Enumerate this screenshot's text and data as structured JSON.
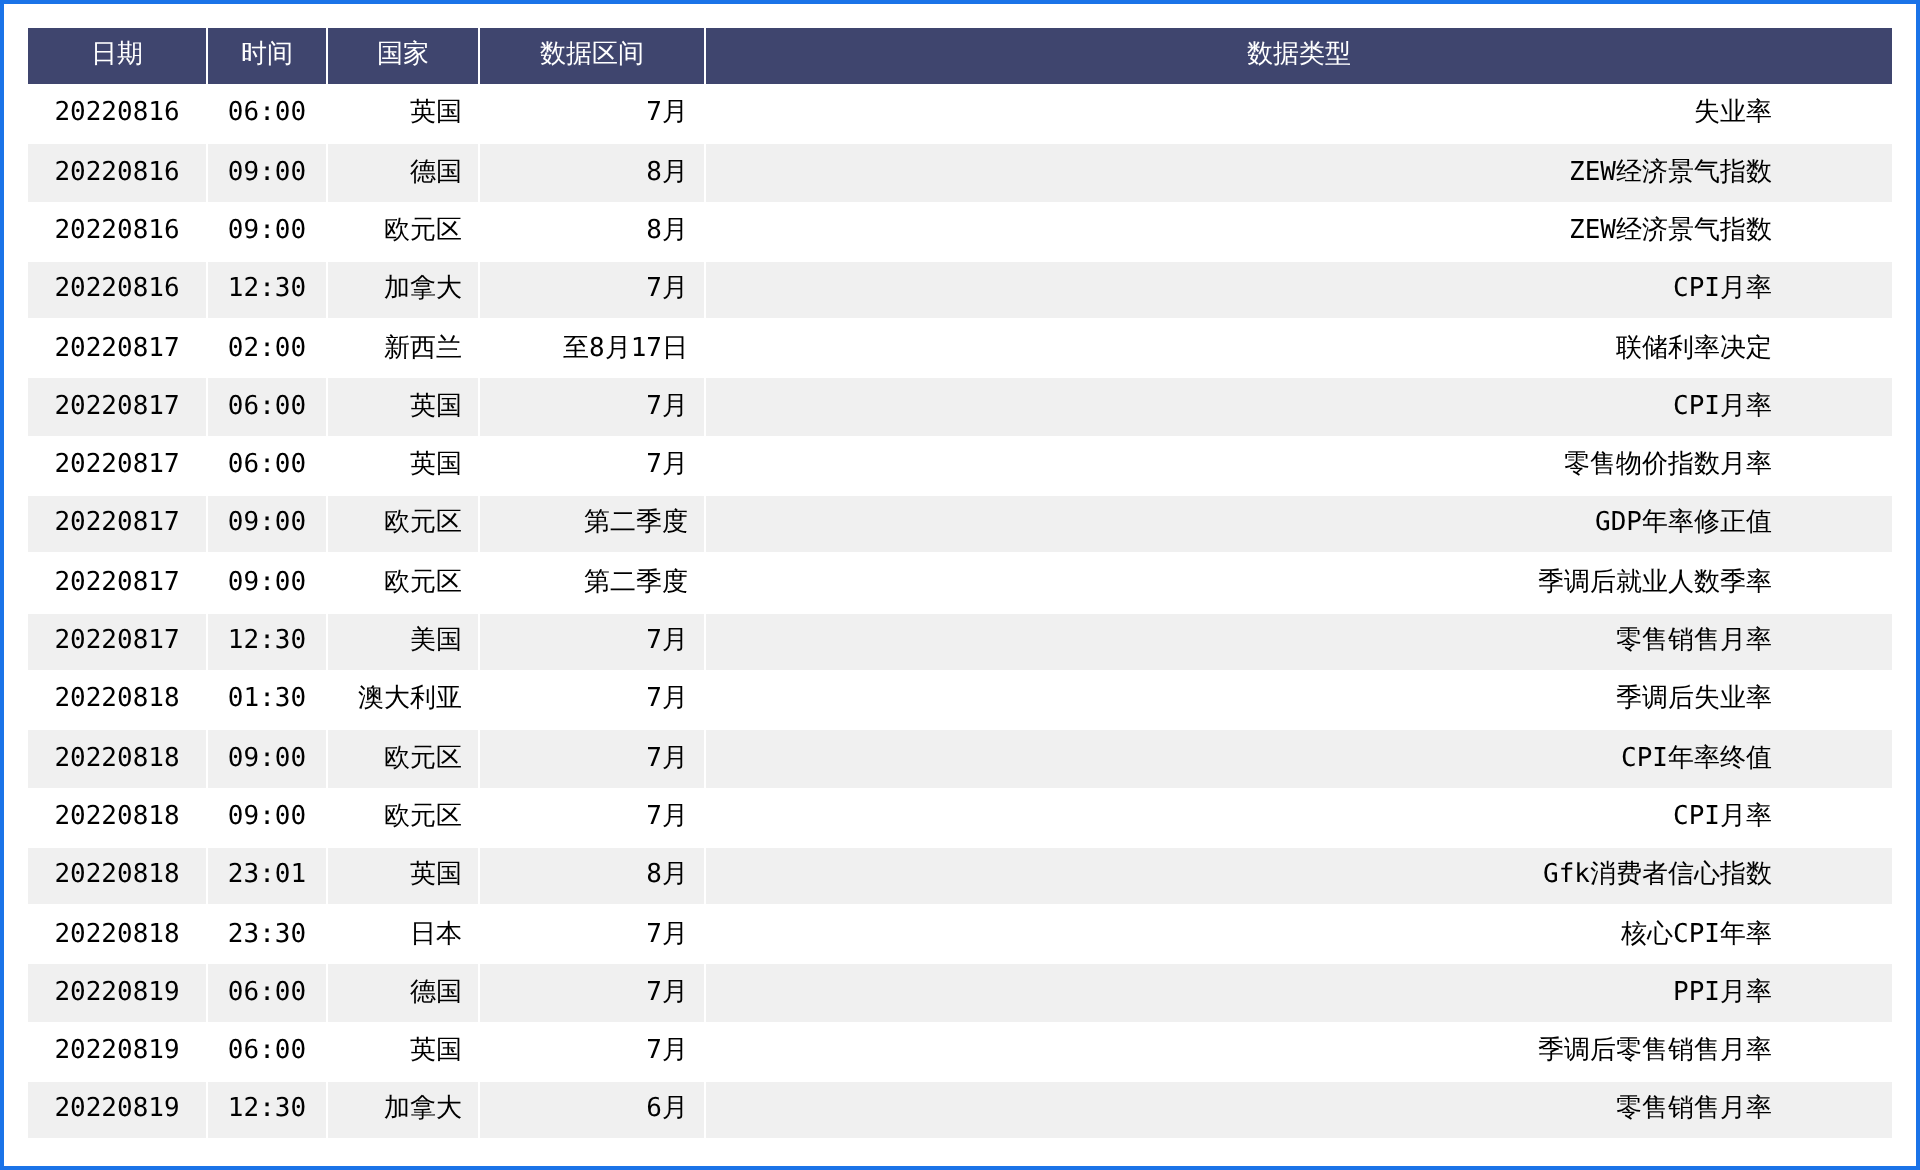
{
  "table": {
    "columns": [
      "日期",
      "时间",
      "国家",
      "数据区间",
      "数据类型"
    ],
    "rows": [
      [
        "20220816",
        "06:00",
        "英国",
        "7月",
        "失业率"
      ],
      [
        "20220816",
        "09:00",
        "德国",
        "8月",
        "ZEW经济景气指数"
      ],
      [
        "20220816",
        "09:00",
        "欧元区",
        "8月",
        "ZEW经济景气指数"
      ],
      [
        "20220816",
        "12:30",
        "加拿大",
        "7月",
        "CPI月率"
      ],
      [
        "20220817",
        "02:00",
        "新西兰",
        "至8月17日",
        "联储利率决定"
      ],
      [
        "20220817",
        "06:00",
        "英国",
        "7月",
        "CPI月率"
      ],
      [
        "20220817",
        "06:00",
        "英国",
        "7月",
        "零售物价指数月率"
      ],
      [
        "20220817",
        "09:00",
        "欧元区",
        "第二季度",
        "GDP年率修正值"
      ],
      [
        "20220817",
        "09:00",
        "欧元区",
        "第二季度",
        "季调后就业人数季率"
      ],
      [
        "20220817",
        "12:30",
        "美国",
        "7月",
        "零售销售月率"
      ],
      [
        "20220818",
        "01:30",
        "澳大利亚",
        "7月",
        "季调后失业率"
      ],
      [
        "20220818",
        "09:00",
        "欧元区",
        "7月",
        "CPI年率终值"
      ],
      [
        "20220818",
        "09:00",
        "欧元区",
        "7月",
        "CPI月率"
      ],
      [
        "20220818",
        "23:01",
        "英国",
        "8月",
        "Gfk消费者信心指数"
      ],
      [
        "20220818",
        "23:30",
        "日本",
        "7月",
        "核心CPI年率"
      ],
      [
        "20220819",
        "06:00",
        "德国",
        "7月",
        "PPI月率"
      ],
      [
        "20220819",
        "06:00",
        "英国",
        "7月",
        "季调后零售销售月率"
      ],
      [
        "20220819",
        "12:30",
        "加拿大",
        "6月",
        "零售销售月率"
      ]
    ]
  }
}
